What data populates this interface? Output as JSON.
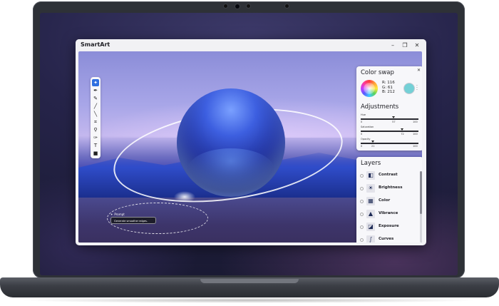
{
  "app": {
    "title": "SmartArt"
  },
  "window_controls": {
    "minimize": "–",
    "maximize": "❐",
    "close": "✕"
  },
  "prompt": {
    "label": "Prompt",
    "text": "Generate smoother edges."
  },
  "color_swap": {
    "title": "Color swap",
    "close": "✕",
    "r": "R: 116",
    "g": "G: 61",
    "b": "B: 212",
    "swatch_color": "#74d0d6"
  },
  "adjustments": {
    "title": "Adjustments",
    "sliders": [
      {
        "label": "Hue",
        "min": "0",
        "value": "57",
        "max": "100",
        "fraction": 0.57
      },
      {
        "label": "Saturation",
        "min": "0",
        "value": "72",
        "max": "100",
        "fraction": 0.72
      },
      {
        "label": "Opacity",
        "min": "0",
        "value": "21",
        "max": "100",
        "fraction": 0.21
      }
    ]
  },
  "layers": {
    "title": "Layers",
    "items": [
      {
        "name": "Contrast",
        "icon": "contrast-icon",
        "glyph": "◧"
      },
      {
        "name": "Brightness",
        "icon": "brightness-icon",
        "glyph": "☀"
      },
      {
        "name": "Color",
        "icon": "color-grid-icon",
        "glyph": "▦"
      },
      {
        "name": "Vibrance",
        "icon": "vibrance-icon",
        "glyph": "▲"
      },
      {
        "name": "Exposure",
        "icon": "exposure-icon",
        "glyph": "◪"
      },
      {
        "name": "Curves",
        "icon": "curves-icon",
        "glyph": "∫"
      }
    ]
  },
  "toolbar": {
    "tools": [
      {
        "name": "magic-wand-tool",
        "glyph": "✦",
        "active": true
      },
      {
        "name": "pen-tool",
        "glyph": "✒"
      },
      {
        "name": "pencil-tool",
        "glyph": "✎"
      },
      {
        "name": "brush-tool",
        "glyph": "╱"
      },
      {
        "name": "line-tool",
        "glyph": "╲"
      },
      {
        "name": "crop-tool",
        "glyph": "⌗"
      },
      {
        "name": "zoom-tool",
        "glyph": "⚲"
      },
      {
        "name": "eyedropper-tool",
        "glyph": "✑"
      },
      {
        "name": "text-tool",
        "glyph": "T"
      },
      {
        "name": "color-fill-tool",
        "glyph": "■"
      }
    ]
  }
}
